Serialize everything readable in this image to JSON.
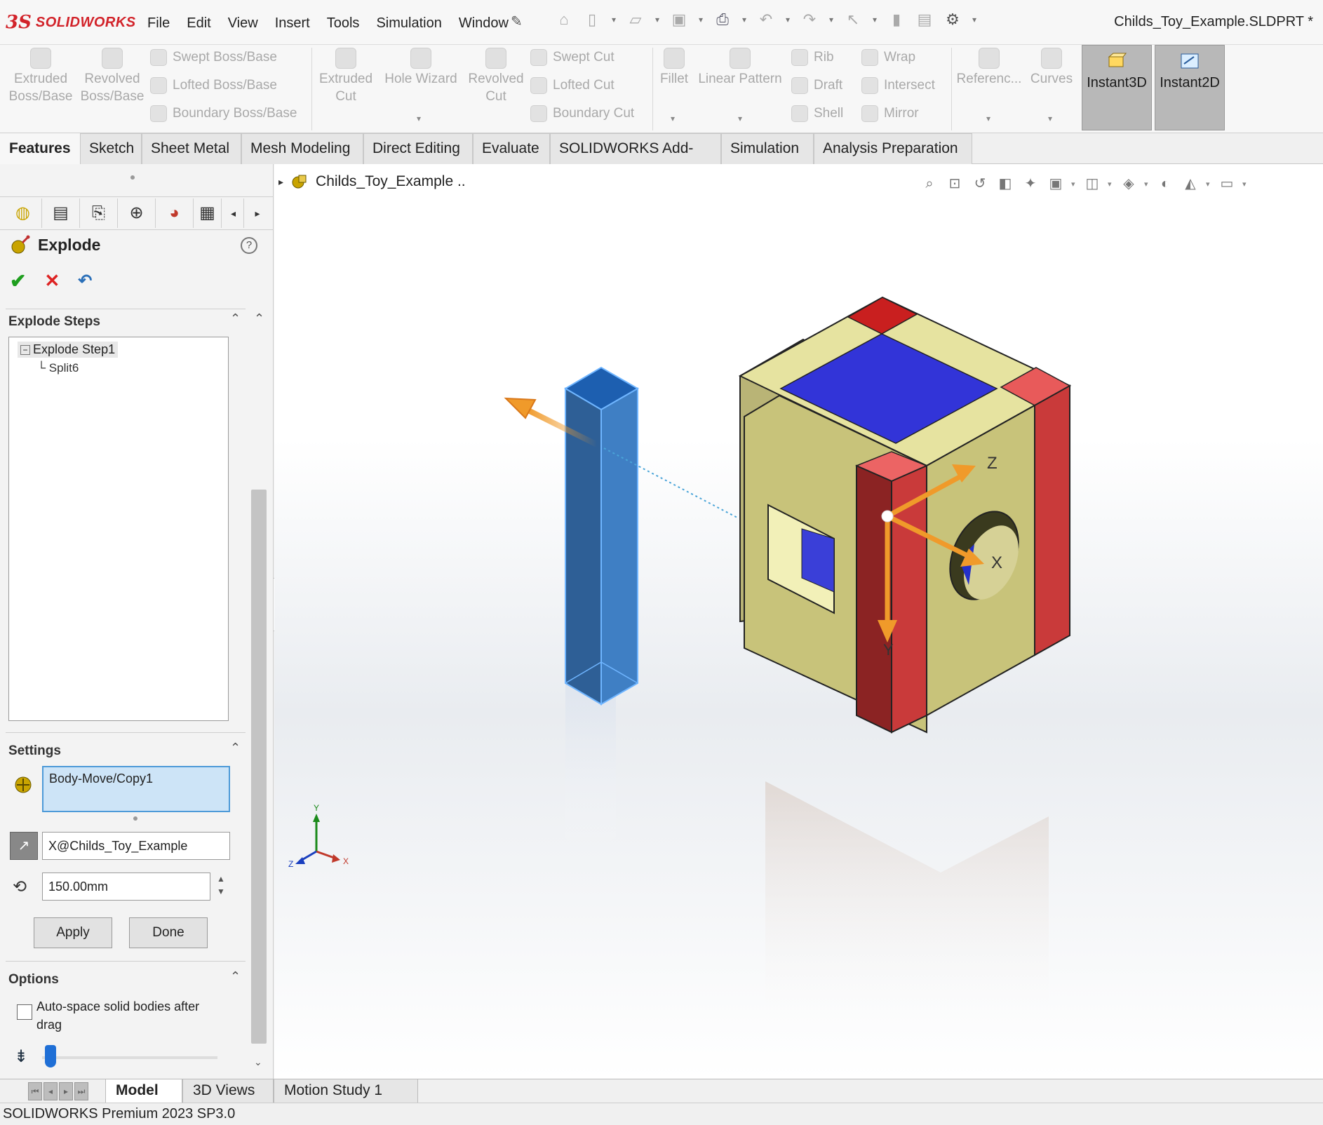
{
  "app": {
    "logo_mark": "3S",
    "logo_word": "SOLIDWORKS",
    "document_title": "Childs_Toy_Example.SLDPRT *"
  },
  "menus": [
    "File",
    "Edit",
    "View",
    "Insert",
    "Tools",
    "Simulation",
    "Window"
  ],
  "commands": {
    "extruded_boss": [
      "Extruded",
      "Boss/Base"
    ],
    "revolved_boss": [
      "Revolved",
      "Boss/Base"
    ],
    "swept_boss": "Swept Boss/Base",
    "lofted_boss": "Lofted Boss/Base",
    "boundary_boss": "Boundary Boss/Base",
    "extruded_cut": [
      "Extruded",
      "Cut"
    ],
    "hole_wizard": "Hole Wizard",
    "revolved_cut": [
      "Revolved",
      "Cut"
    ],
    "swept_cut": "Swept Cut",
    "lofted_cut": "Lofted Cut",
    "boundary_cut": "Boundary Cut",
    "fillet": "Fillet",
    "linear_pattern": "Linear Pattern",
    "rib": "Rib",
    "draft": "Draft",
    "shell": "Shell",
    "wrap": "Wrap",
    "intersect": "Intersect",
    "mirror": "Mirror",
    "reference": "Referenc...",
    "curves": "Curves",
    "instant3d": "Instant3D",
    "instant2d": "Instant2D"
  },
  "tabs": [
    "Features",
    "Sketch",
    "Sheet Metal",
    "Mesh Modeling",
    "Direct Editing",
    "Evaluate",
    "SOLIDWORKS Add-Ins",
    "Simulation",
    "Analysis Preparation"
  ],
  "panel": {
    "title": "Explode",
    "explode_steps": {
      "heading": "Explode Steps",
      "step": "Explode Step1",
      "child": "Split6"
    },
    "settings": {
      "heading": "Settings",
      "body": "Body-Move/Copy1",
      "direction": "X@Childs_Toy_Example",
      "distance": "150.00mm",
      "apply": "Apply",
      "done": "Done"
    },
    "options": {
      "heading": "Options",
      "auto_space": "Auto-space solid bodies after drag",
      "auto_space_checked": false
    }
  },
  "viewport": {
    "tree_root": "Childs_Toy_Example ..",
    "triad_labels": [
      "X",
      "Y",
      "Z"
    ],
    "small_triad_labels": [
      "Y",
      "X",
      "Z"
    ],
    "colors": {
      "cube_body": "#c8c37a",
      "cube_light": "#e6e3a0",
      "red_strip": "#c93a3a",
      "top_square": "#3234d8",
      "bar": "#3f7fc4",
      "arrow": "#f09a2a"
    }
  },
  "bottom_tabs": [
    "Model",
    "3D Views",
    "Motion Study 1"
  ],
  "status": "SOLIDWORKS Premium 2023 SP3.0"
}
